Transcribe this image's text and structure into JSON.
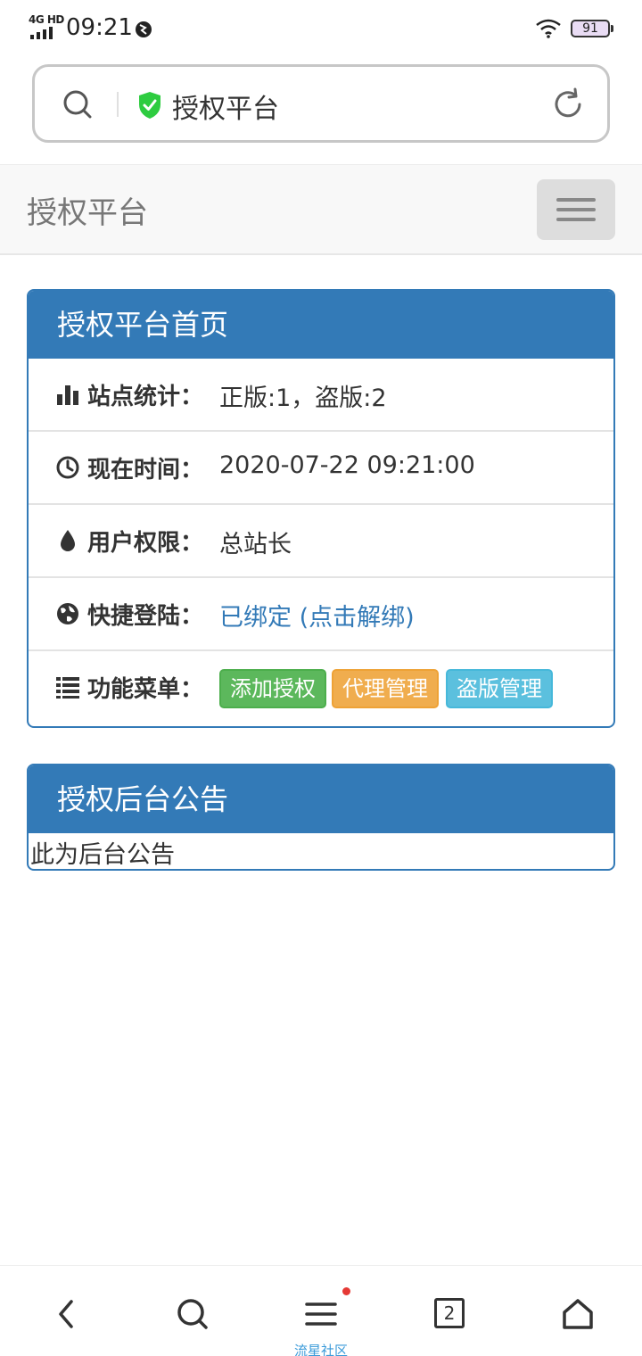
{
  "status_bar": {
    "network": "4G HD",
    "time": "09:21",
    "battery": "91"
  },
  "address_bar": {
    "title": "授权平台"
  },
  "navbar": {
    "brand": "授权平台"
  },
  "home_panel": {
    "heading": "授权平台首页",
    "rows": [
      {
        "icon": "bar-chart-icon",
        "label": "站点统计：",
        "value": "正版:1，盗版:2"
      },
      {
        "icon": "clock-icon",
        "label": "现在时间：",
        "value": "2020-07-22 09:21:00"
      },
      {
        "icon": "drop-icon",
        "label": "用户权限：",
        "value": "总站长"
      },
      {
        "icon": "globe-icon",
        "label": "快捷登陆：",
        "value": "已绑定 (点击解绑)"
      },
      {
        "icon": "list-icon",
        "label": "功能菜单：",
        "value": ""
      }
    ],
    "menu_buttons": {
      "add_auth": "添加授权",
      "agent_manage": "代理管理",
      "piracy_manage": "盗版管理"
    }
  },
  "notice_panel": {
    "heading": "授权后台公告",
    "body": "此为后台公告"
  },
  "bottom_bar": {
    "tab_count": "2",
    "menu_label": "流星社区"
  },
  "colors": {
    "primary": "#337ab7",
    "success": "#5cb85c",
    "warning": "#f0ad4e",
    "info": "#5bc0de",
    "shield": "#2ecc40",
    "badge": "#e53935"
  }
}
